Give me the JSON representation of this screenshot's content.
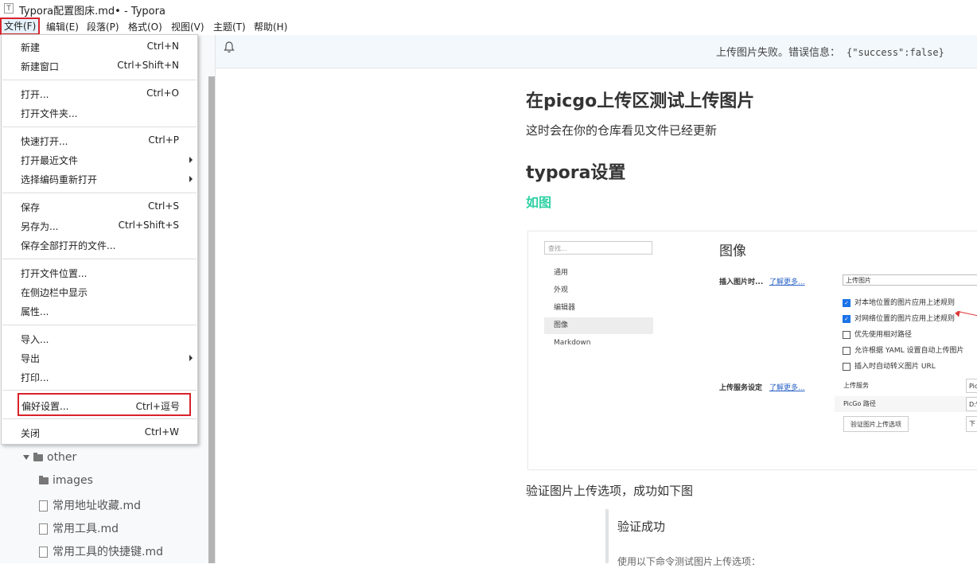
{
  "window": {
    "title": "Typora配置图床.md• - Typora",
    "app_icon": "T"
  },
  "menubar": {
    "items": [
      "文件(F)",
      "编辑(E)",
      "段落(P)",
      "格式(O)",
      "视图(V)",
      "主题(T)",
      "帮助(H)"
    ]
  },
  "file_menu": {
    "items": [
      {
        "label": "新建",
        "shortcut": "Ctrl+N"
      },
      {
        "label": "新建窗口",
        "shortcut": "Ctrl+Shift+N"
      },
      {
        "label": "打开...",
        "shortcut": "Ctrl+O"
      },
      {
        "label": "打开文件夹...",
        "shortcut": ""
      },
      {
        "label": "快速打开...",
        "shortcut": "Ctrl+P"
      },
      {
        "label": "打开最近文件",
        "shortcut": ""
      },
      {
        "label": "选择编码重新打开",
        "shortcut": ""
      },
      {
        "label": "保存",
        "shortcut": "Ctrl+S"
      },
      {
        "label": "另存为...",
        "shortcut": "Ctrl+Shift+S"
      },
      {
        "label": "保存全部打开的文件...",
        "shortcut": ""
      },
      {
        "label": "打开文件位置...",
        "shortcut": ""
      },
      {
        "label": "在侧边栏中显示",
        "shortcut": ""
      },
      {
        "label": "属性...",
        "shortcut": ""
      },
      {
        "label": "导入...",
        "shortcut": ""
      },
      {
        "label": "导出",
        "shortcut": ""
      },
      {
        "label": "打印...",
        "shortcut": ""
      },
      {
        "label": "偏好设置...",
        "shortcut": "Ctrl+逗号"
      },
      {
        "label": "关闭",
        "shortcut": "Ctrl+W"
      }
    ]
  },
  "sidebar": {
    "folder": "other",
    "items": [
      "images",
      "常用地址收藏.md",
      "常用工具.md",
      "常用工具的快捷键.md"
    ]
  },
  "notification": {
    "message": "上传图片失败。错误信息：",
    "code": "{\"success\":false}"
  },
  "document": {
    "h1": "在picgo上传区测试上传图片",
    "p1": "这时会在你的仓库看见文件已经更新",
    "h2": "typora设置",
    "green_heading": "如图",
    "p2": "验证图片上传选项，成功如下图",
    "quote_title": "验证成功",
    "quote_text": "使用以下命令测试图片上传选项："
  },
  "embedded_settings": {
    "search_placeholder": "查找...",
    "nav": [
      "通用",
      "外观",
      "编辑器",
      "图像",
      "Markdown"
    ],
    "heading": "图像",
    "insert_label": "插入图片时...",
    "learn_more": "了解更多...",
    "insert_select": "上传图片",
    "checks": [
      {
        "label": "对本地位置的图片应用上述规则",
        "checked": true
      },
      {
        "label": "对网络位置的图片应用上述规则",
        "checked": true
      },
      {
        "label": "优先使用相对路径",
        "checked": false
      },
      {
        "label": "允许根据 YAML 设置自动上传图片",
        "checked": false
      },
      {
        "label": "插入时自动转义图片 URL",
        "checked": false
      }
    ],
    "upload_label": "上传服务设定",
    "upload_service": "上传服务",
    "upload_service_value": "Pic",
    "picgo_path": "PicGo 路径",
    "picgo_path_value": "D:\\",
    "verify_button": "验证图片上传选项",
    "edge_button": "下"
  }
}
